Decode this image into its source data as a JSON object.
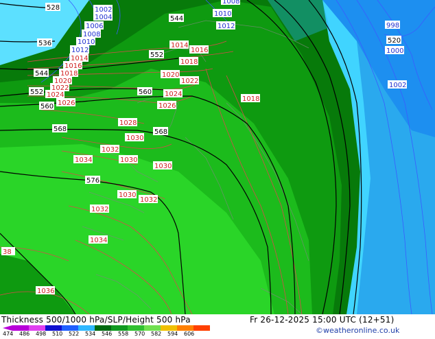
{
  "title": "Thickness 500/1000 hPa/SLP/Height 500 hPa",
  "valid_time": "Fr 26-12-2025 15:00 UTC (12+51)",
  "credit": "©weatheronline.co.uk",
  "legend": {
    "ticks": [
      "474",
      "486",
      "498",
      "510",
      "522",
      "534",
      "546",
      "558",
      "570",
      "582",
      "594",
      "606"
    ],
    "colors": [
      "#b800d8",
      "#e040f0",
      "#1010d0",
      "#2060ff",
      "#30b8ff",
      "#006a10",
      "#109a20",
      "#30c030",
      "#70e050",
      "#f0c000",
      "#ff8000",
      "#ff4000"
    ]
  },
  "thickness_labels": [
    "528",
    "536",
    "544",
    "552",
    "560",
    "568",
    "576"
  ],
  "height_labels": [
    "544",
    "552",
    "560",
    "568",
    "576",
    "520"
  ],
  "slp_labels_blue": [
    "1002",
    "1004",
    "1006",
    "1008",
    "1010",
    "1012",
    "1010",
    "1012",
    "998",
    "1000",
    "1002",
    "1008"
  ],
  "slp_labels_red": [
    "1014",
    "1016",
    "1018",
    "1020",
    "1022",
    "1024",
    "1026",
    "1028",
    "1030",
    "1032",
    "1034",
    "1030",
    "1030",
    "1030",
    "1032",
    "1034",
    "1036",
    "1014",
    "1016",
    "1018",
    "1020",
    "1022",
    "1024",
    "1026",
    "1018",
    "1030",
    "1032",
    "1036",
    "38"
  ]
}
